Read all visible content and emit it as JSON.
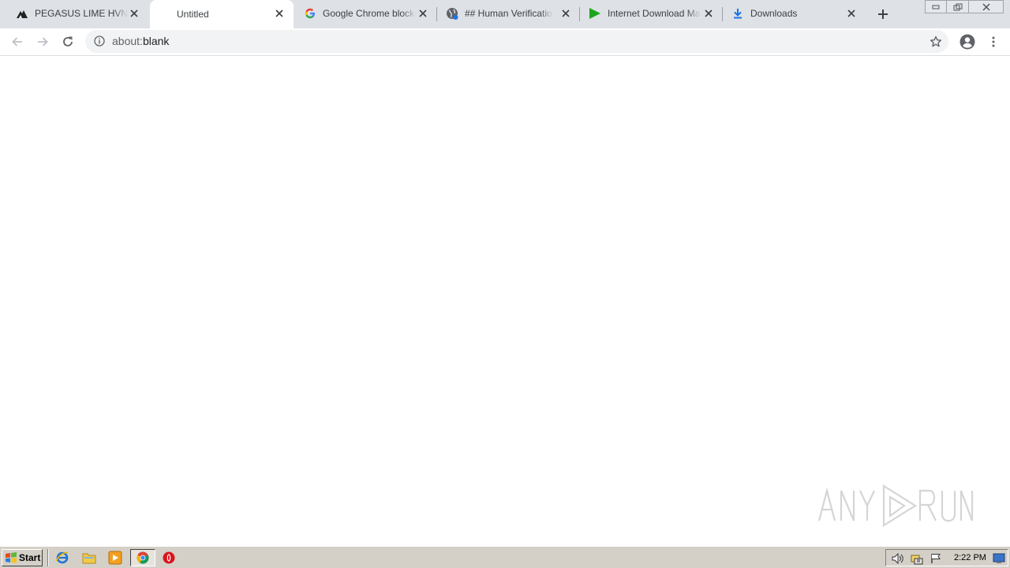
{
  "tabs": [
    {
      "title": "PEGASUS LIME HVNC.exe",
      "icon": "pegasus-icon",
      "active": false
    },
    {
      "title": "Untitled",
      "icon": "",
      "active": true
    },
    {
      "title": "Google Chrome blocks some",
      "icon": "google-g-icon",
      "active": false
    },
    {
      "title": "## Human Verification ##",
      "icon": "globe-icon",
      "active": false
    },
    {
      "title": "Internet Download Manager",
      "icon": "idm-play-icon",
      "active": false
    },
    {
      "title": "Downloads",
      "icon": "download-icon",
      "active": false
    }
  ],
  "omnibox": {
    "scheme": "about:",
    "rest": "blank"
  },
  "taskbar": {
    "start_label": "Start",
    "clock": "2:22 PM"
  },
  "watermark": {
    "text_left": "ANY",
    "text_right": "RUN"
  },
  "colors": {
    "tabstrip": "#dee1e6",
    "accent_blue": "#1a73e8",
    "taskbar": "#d4d0c8"
  }
}
